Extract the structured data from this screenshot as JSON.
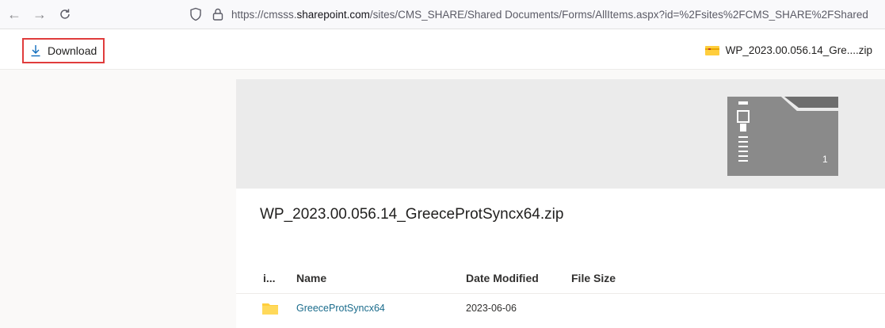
{
  "browser": {
    "nav_back_glyph": "←",
    "nav_forward_glyph": "→",
    "reload_glyph": "C",
    "url_prefix": "https://cmsss.",
    "url_host": "sharepoint.com",
    "url_suffix": "/sites/CMS_SHARE/Shared Documents/Forms/AllItems.aspx?id=%2Fsites%2FCMS_SHARE%2FShared"
  },
  "command_bar": {
    "download_label": "Download",
    "file_name": "WP_2023.00.056.14_Gre....zip"
  },
  "preview": {
    "thumb_count": "1",
    "zip_title": "WP_2023.00.056.14_GreeceProtSyncx64.zip",
    "columns": {
      "icon": "i...",
      "name": "Name",
      "date_modified": "Date Modified",
      "file_size": "File Size"
    },
    "rows": [
      {
        "name": "GreeceProtSyncx64",
        "date_modified": "2023-06-06",
        "file_size": ""
      }
    ]
  },
  "colors": {
    "highlight_border": "#e03c3c",
    "folder_yellow": "#ffce3d",
    "link_teal": "#1b6c8c",
    "hero_bg": "#ebebeb",
    "zip_gray": "#8a8a8a"
  }
}
